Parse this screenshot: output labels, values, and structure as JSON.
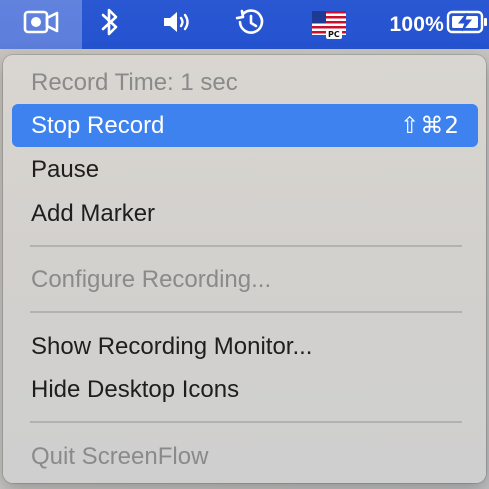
{
  "menubar": {
    "background_color": "#2552cf",
    "icons": {
      "camera": "video-camera-icon",
      "bluetooth": "bluetooth-icon",
      "volume": "speaker-volume-icon",
      "time_machine": "time-machine-icon",
      "input_source": "us-flag-icon",
      "battery": "battery-charging-icon"
    },
    "input_source_badge": "PC",
    "battery_percent": "100%"
  },
  "menu": {
    "highlight_color": "#3d82ef",
    "items": [
      {
        "label": "Record Time: 1 sec",
        "enabled": false
      },
      {
        "label": "Stop Record",
        "enabled": true,
        "highlighted": true,
        "shortcut": "⇧⌘2"
      },
      {
        "label": "Pause",
        "enabled": true
      },
      {
        "label": "Add Marker",
        "enabled": true
      },
      {
        "label": "Configure Recording...",
        "enabled": false
      },
      {
        "label": "Show Recording Monitor...",
        "enabled": true
      },
      {
        "label": "Hide Desktop Icons",
        "enabled": true
      },
      {
        "label": "Quit ScreenFlow",
        "enabled": false
      }
    ]
  }
}
